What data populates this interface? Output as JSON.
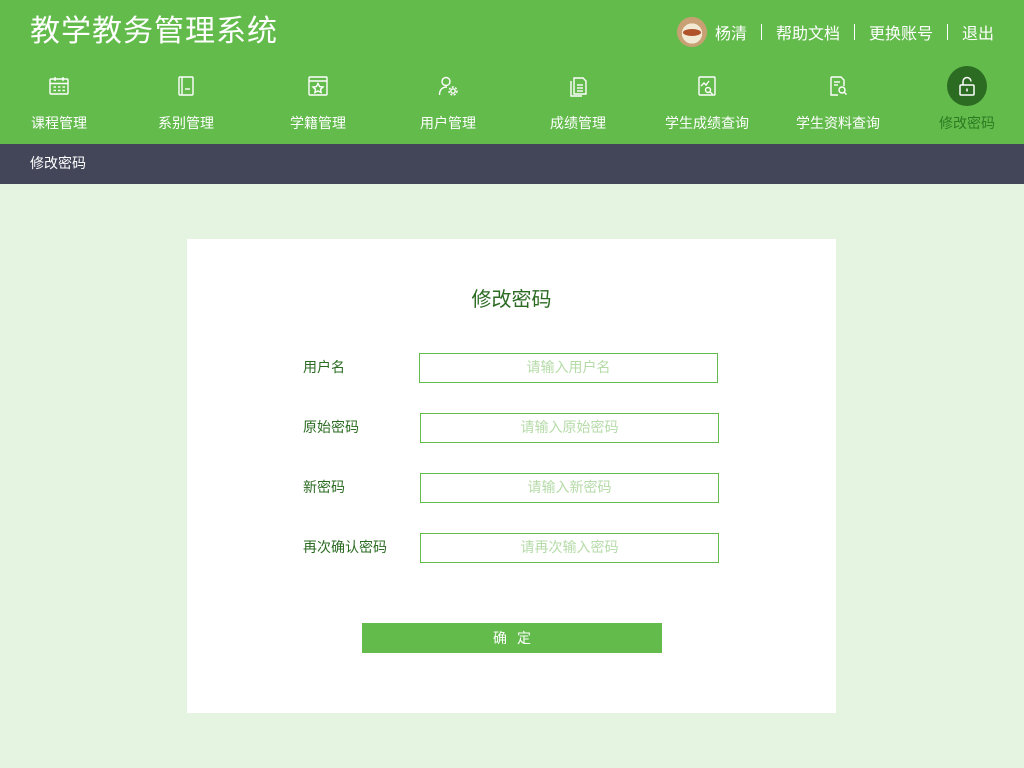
{
  "app": {
    "title": "教学教务管理系统"
  },
  "user": {
    "name": "杨清",
    "links": [
      "帮助文档",
      "更换账号",
      "退出"
    ]
  },
  "nav": {
    "items": [
      {
        "label": "课程管理",
        "icon": "calendar-icon"
      },
      {
        "label": "系别管理",
        "icon": "book-icon"
      },
      {
        "label": "学籍管理",
        "icon": "star-card-icon"
      },
      {
        "label": "用户管理",
        "icon": "user-gear-icon"
      },
      {
        "label": "成绩管理",
        "icon": "documents-icon"
      },
      {
        "label": "学生成绩查询",
        "icon": "chart-search-icon"
      },
      {
        "label": "学生资料查询",
        "icon": "file-search-icon"
      },
      {
        "label": "修改密码",
        "icon": "unlock-icon",
        "active": true
      }
    ]
  },
  "breadcrumb": "修改密码",
  "form": {
    "title": "修改密码",
    "fields": [
      {
        "label": "用户名",
        "placeholder": "请输入用户名",
        "value": ""
      },
      {
        "label": "原始密码",
        "placeholder": "请输入原始密码",
        "value": ""
      },
      {
        "label": "新密码",
        "placeholder": "请输入新密码",
        "value": ""
      },
      {
        "label": "再次确认密码",
        "placeholder": "请再次输入密码",
        "value": ""
      }
    ],
    "submit_label": "确定"
  },
  "colors": {
    "header": "#63bb4c",
    "breadcrumb_bar": "#434659",
    "page_bg": "#e5f3e1",
    "accent_dark": "#2b6b22"
  }
}
